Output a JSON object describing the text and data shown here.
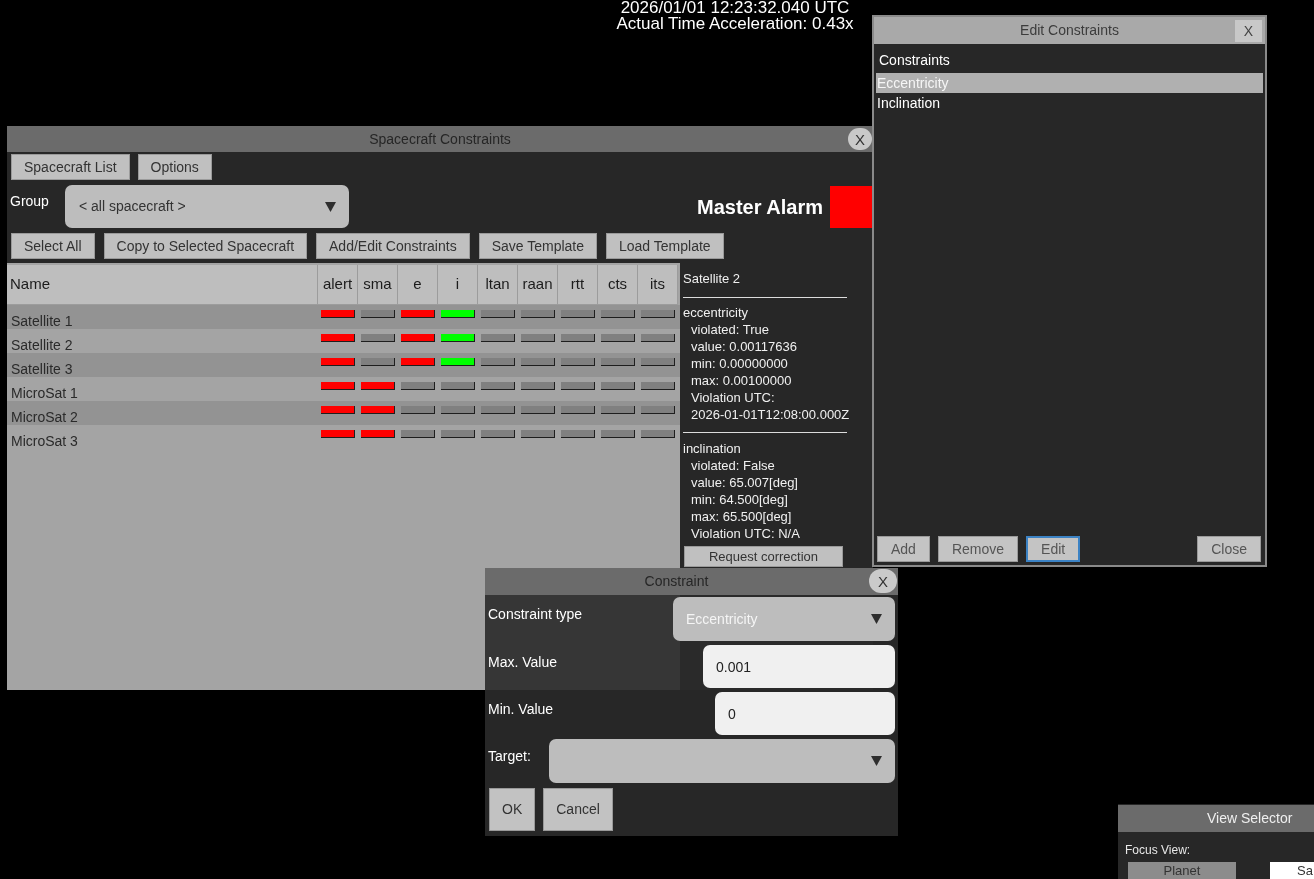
{
  "clock": {
    "date_time": "2026/01/01 12:23:32.040 UTC",
    "acceleration": "Actual Time Acceleration: 0.43x"
  },
  "spacecraft_constraints": {
    "title": "Spacecraft Constraints",
    "close": "X",
    "top_buttons": [
      "Spacecraft List",
      "Options"
    ],
    "group": {
      "label": "Group",
      "value": "< all spacecraft >"
    },
    "master_alarm": {
      "label": "Master Alarm",
      "color": "#ff0000"
    },
    "action_buttons": [
      "Select All",
      "Copy to Selected Spacecraft",
      "Add/Edit Constraints",
      "Save Template",
      "Load Template"
    ],
    "table": {
      "columns": [
        "Name",
        "alert",
        "sma",
        "e",
        "i",
        "ltan",
        "raan",
        "rtt",
        "cts",
        "its"
      ],
      "rows": [
        {
          "name": "Satellite 1",
          "indicators": [
            {
              "color": "#ff0000"
            },
            {
              "color": "#808080"
            },
            {
              "color": "#ff0000"
            },
            {
              "color": "#00ff00"
            },
            {
              "color": "#808080"
            },
            {
              "color": "#808080"
            },
            {
              "color": "#808080"
            },
            {
              "color": "#808080"
            },
            {
              "color": "#808080"
            }
          ]
        },
        {
          "name": "Satellite 2",
          "indicators": [
            {
              "color": "#ff0000"
            },
            {
              "color": "#808080"
            },
            {
              "color": "#ff0000"
            },
            {
              "color": "#00ff00"
            },
            {
              "color": "#808080"
            },
            {
              "color": "#808080"
            },
            {
              "color": "#808080"
            },
            {
              "color": "#808080"
            },
            {
              "color": "#808080"
            }
          ]
        },
        {
          "name": "Satellite 3",
          "indicators": [
            {
              "color": "#ff0000"
            },
            {
              "color": "#808080"
            },
            {
              "color": "#ff0000"
            },
            {
              "color": "#00ff00"
            },
            {
              "color": "#808080"
            },
            {
              "color": "#808080"
            },
            {
              "color": "#808080"
            },
            {
              "color": "#808080"
            },
            {
              "color": "#808080"
            }
          ]
        },
        {
          "name": "MicroSat 1",
          "indicators": [
            {
              "color": "#ff0000"
            },
            {
              "color": "#ff0000"
            },
            {
              "color": "#808080"
            },
            {
              "color": "#808080"
            },
            {
              "color": "#808080"
            },
            {
              "color": "#808080"
            },
            {
              "color": "#808080"
            },
            {
              "color": "#808080"
            },
            {
              "color": "#808080"
            }
          ]
        },
        {
          "name": "MicroSat 2",
          "indicators": [
            {
              "color": "#ff0000"
            },
            {
              "color": "#ff0000"
            },
            {
              "color": "#808080"
            },
            {
              "color": "#808080"
            },
            {
              "color": "#808080"
            },
            {
              "color": "#808080"
            },
            {
              "color": "#808080"
            },
            {
              "color": "#808080"
            },
            {
              "color": "#808080"
            }
          ]
        },
        {
          "name": "MicroSat 3",
          "indicators": [
            {
              "color": "#ff0000"
            },
            {
              "color": "#ff0000"
            },
            {
              "color": "#808080"
            },
            {
              "color": "#808080"
            },
            {
              "color": "#808080"
            },
            {
              "color": "#808080"
            },
            {
              "color": "#808080"
            },
            {
              "color": "#808080"
            },
            {
              "color": "#808080"
            }
          ]
        }
      ]
    },
    "details": {
      "title": "Satellite 2",
      "sections": [
        {
          "name": "eccentricity",
          "lines": [
            "violated: True",
            "value: 0.00117636",
            "min: 0.00000000",
            "max: 0.00100000",
            "Violation UTC:",
            "2026-01-01T12:08:00.000Z"
          ]
        },
        {
          "name": "inclination",
          "lines": [
            "violated: False",
            "value: 65.007[deg]",
            "min: 64.500[deg]",
            "max: 65.500[deg]",
            "Violation UTC: N/A"
          ]
        }
      ],
      "button": "Request correction"
    }
  },
  "edit_constraints": {
    "title": "Edit Constraints",
    "close": "X",
    "list_label": "Constraints",
    "items": [
      {
        "label": "Eccentricity",
        "selected": true
      },
      {
        "label": "Inclination",
        "selected": false
      }
    ],
    "buttons": [
      {
        "label": "Add",
        "focused": false
      },
      {
        "label": "Remove",
        "focused": false
      },
      {
        "label": "Edit",
        "focused": true
      },
      {
        "label": "Close",
        "focused": false
      }
    ]
  },
  "constraint": {
    "title": "Constraint",
    "close": "X",
    "fields": [
      {
        "kind": "dropdown",
        "label": "Constraint type",
        "value": "Eccentricity"
      },
      {
        "kind": "input",
        "label": "Max. Value",
        "value": "0.001"
      },
      {
        "kind": "input",
        "label": "Min. Value",
        "value": "0"
      },
      {
        "kind": "dropdown",
        "label": "Target:"
      }
    ],
    "buttons": [
      "OK",
      "Cancel"
    ]
  },
  "view_selector": {
    "title": "View Selector",
    "label": "Focus View:",
    "buttons": [
      {
        "label": "Planet",
        "selected": false
      },
      {
        "label": "Sa",
        "selected": true
      }
    ]
  }
}
